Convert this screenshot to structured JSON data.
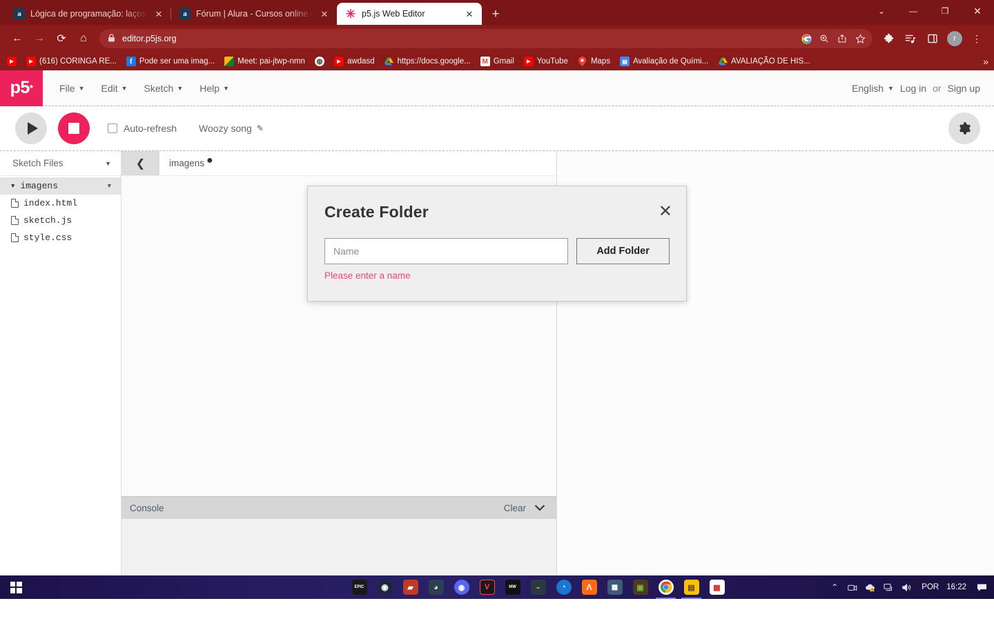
{
  "browser": {
    "tabs": [
      {
        "title": "Lógica de programação: laços e l",
        "favicon": "alura-icon",
        "active": false,
        "close_label": "✕"
      },
      {
        "title": "Fórum | Alura - Cursos online de",
        "favicon": "alura-icon",
        "active": false,
        "close_label": "✕"
      },
      {
        "title": "p5.js Web Editor",
        "favicon": "p5-asterisk-icon",
        "active": true,
        "close_label": "✕"
      }
    ],
    "new_tab_label": "+",
    "window_controls": {
      "minimize_group": "⌄",
      "minimize": "—",
      "maximize": "❐",
      "close": "✕"
    },
    "nav": {
      "back": "←",
      "forward": "→",
      "reload": "⟳",
      "home": "⌂",
      "url": "editor.p5js.org",
      "lock": "🔒"
    },
    "omnibox_icons": [
      "google-g-icon",
      "zoom-icon",
      "share-icon",
      "bookmark-star-icon"
    ],
    "toolbar_icons": [
      "extensions-puzzle-icon",
      "reading-list-icon",
      "side-panel-icon"
    ],
    "profile_initial": "r",
    "menu_label": "⋮",
    "bookmarks": [
      {
        "label": "(616) CORINGA RE...",
        "icon": "youtube-icon"
      },
      {
        "label": "Pode ser uma imag...",
        "icon": "facebook-icon"
      },
      {
        "label": "Meet: pai-jtwp-nmn",
        "icon": "google-meet-icon"
      },
      {
        "label": "awdasd",
        "icon": "youtube-icon"
      },
      {
        "label": "https://docs.google...",
        "icon": "google-drive-icon"
      },
      {
        "label": "Gmail",
        "icon": "gmail-icon"
      },
      {
        "label": "YouTube",
        "icon": "youtube-icon"
      },
      {
        "label": "Maps",
        "icon": "google-maps-icon"
      },
      {
        "label": "Avaliação de Quími...",
        "icon": "google-forms-icon"
      },
      {
        "label": "AVALIAÇÃO DE HIS...",
        "icon": "google-drive-icon"
      }
    ],
    "bookmarks_overflow": "»"
  },
  "p5": {
    "logo": "p5",
    "logo_sup": "*",
    "menu": [
      {
        "label": "File",
        "caret": "▼"
      },
      {
        "label": "Edit",
        "caret": "▼"
      },
      {
        "label": "Sketch",
        "caret": "▼"
      },
      {
        "label": "Help",
        "caret": "▼"
      }
    ],
    "language": {
      "label": "English",
      "caret": "▼"
    },
    "login_label": "Log in",
    "or_label": "or",
    "signup_label": "Sign up",
    "toolbar": {
      "play_label": "▶",
      "stop_label": "■",
      "autorefresh_label": "Auto-refresh",
      "autorefresh_checked": false,
      "sketch_name": "Woozy song",
      "edit_pencil": "✎",
      "settings_icon": "gear-icon"
    },
    "sidebar": {
      "header": "Sketch Files",
      "header_caret": "▼",
      "items": [
        {
          "label": "imagens",
          "type": "folder",
          "expanded": true,
          "caret": "▼",
          "menu_caret": "▼"
        },
        {
          "label": "index.html",
          "type": "file"
        },
        {
          "label": "sketch.js",
          "type": "file"
        },
        {
          "label": "style.css",
          "type": "file"
        }
      ]
    },
    "editor": {
      "back_label": "❮",
      "breadcrumb": "imagens",
      "unsaved_dot": "●"
    },
    "console": {
      "title": "Console",
      "clear_label": "Clear",
      "collapse_caret": "⌄"
    }
  },
  "modal": {
    "title": "Create Folder",
    "close_label": "✕",
    "input_placeholder": "Name",
    "input_value": "",
    "submit_label": "Add Folder",
    "error_message": "Please enter a name",
    "error_color": "#ed487a"
  },
  "taskbar": {
    "start_label": "windows-start-icon",
    "apps": [
      {
        "name": "epic-games-icon",
        "glyph": "EPIC",
        "bg": "#1a1a1a",
        "running": false
      },
      {
        "name": "steam-icon",
        "glyph": "◉",
        "bg": "#1b2838",
        "running": false
      },
      {
        "name": "pocket-tanks-icon",
        "glyph": "▰",
        "bg": "#c0392b",
        "running": false
      },
      {
        "name": "nvidia-icon",
        "glyph": "◕",
        "bg": "#2c3e50",
        "running": false
      },
      {
        "name": "discord-icon",
        "glyph": "◉",
        "bg": "#5865f2",
        "running": false
      },
      {
        "name": "valorant-icon",
        "glyph": "V",
        "bg": "#1a1a1a",
        "running": false
      },
      {
        "name": "call-of-duty-icon",
        "glyph": "MW",
        "bg": "#111111",
        "running": false
      },
      {
        "name": "davinci-resolve-icon",
        "glyph": "◒",
        "bg": "#2b3a42",
        "running": false
      },
      {
        "name": "blender-icon",
        "glyph": "◔",
        "bg": "#1976d2",
        "running": false
      },
      {
        "name": "autodesk-icon",
        "glyph": "A",
        "bg": "#ff6a13",
        "running": false
      },
      {
        "name": "cities-skylines-icon",
        "glyph": "▦",
        "bg": "#3f5a78",
        "running": false
      },
      {
        "name": "minecraft-icon",
        "glyph": "▣",
        "bg": "#4a3a22",
        "running": false
      },
      {
        "name": "google-chrome-icon",
        "glyph": "◉",
        "bg": "#ffffff",
        "running": true
      },
      {
        "name": "file-explorer-icon",
        "glyph": "▤",
        "bg": "#ffc107",
        "running": true
      },
      {
        "name": "microsoft-store-icon",
        "glyph": "▩",
        "bg": "#ffffff",
        "running": false
      }
    ],
    "tray": {
      "show_hidden": "⌃",
      "icons": [
        "camera-icon",
        "cloud-warning-icon",
        "network-icon",
        "volume-icon"
      ],
      "language": "POR",
      "clock": "16:22",
      "notifications": "notification-icon"
    }
  }
}
